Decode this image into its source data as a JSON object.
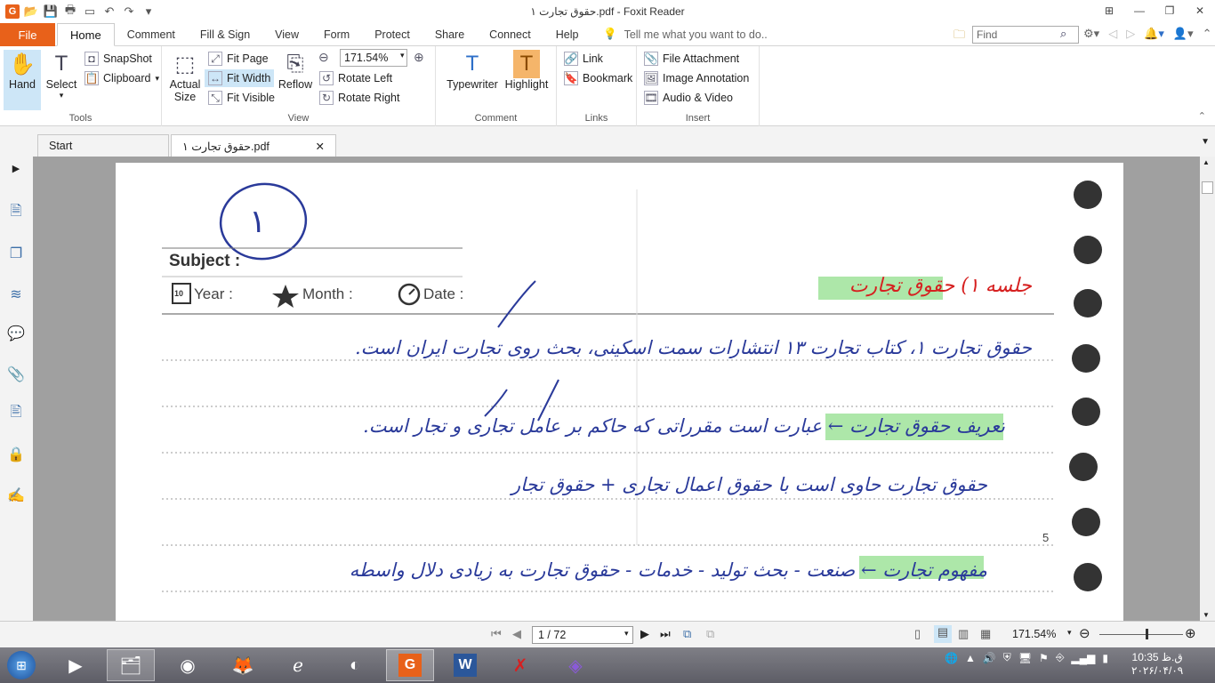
{
  "window": {
    "title": "حقوق تجارت ۱.pdf - Foxit Reader"
  },
  "menu": {
    "file": "File",
    "tabs": [
      "Home",
      "Comment",
      "Fill & Sign",
      "View",
      "Form",
      "Protect",
      "Share",
      "Connect",
      "Help"
    ],
    "tellme": "Tell me what you want to do..",
    "find_placeholder": "Find"
  },
  "ribbon": {
    "tools": {
      "hand": "Hand",
      "select": "Select",
      "snapshot": "SnapShot",
      "clipboard": "Clipboard",
      "label": "Tools"
    },
    "view": {
      "actual_size_1": "Actual",
      "actual_size_2": "Size",
      "fit_page": "Fit Page",
      "fit_width": "Fit Width",
      "fit_visible": "Fit Visible",
      "reflow": "Reflow",
      "zoom": "171.54%",
      "rotate_left": "Rotate Left",
      "rotate_right": "Rotate Right",
      "label": "View"
    },
    "comment": {
      "typewriter": "Typewriter",
      "highlight": "Highlight",
      "label": "Comment"
    },
    "links": {
      "link": "Link",
      "bookmark": "Bookmark",
      "label": "Links"
    },
    "insert": {
      "file_attachment": "File Attachment",
      "image_annotation": "Image Annotation",
      "audio_video": "Audio & Video",
      "label": "Insert"
    }
  },
  "doc_tabs": {
    "start": "Start",
    "current": "حقوق تجارت ۱.pdf"
  },
  "page": {
    "circled_number": "۱",
    "subject": "Subject :",
    "year": "Year :",
    "month": "Month :",
    "date": "Date :",
    "calendar_num": "10",
    "heading": "جلسه ۱) حقوق تجارت",
    "line1": "حقوق تجارت ۱، کتاب تجارت ۱۳ انتشارات سمت اسکینی، بحث روی تجارت ایران است.",
    "line2": "تعریف حقوق تجارت ← عبارت است مقرراتی که حاکم بر عامل تجاری و تجار است.",
    "line3": "حقوق تجارت حاوی است با حقوق اعمال تجاری + حقوق تجار",
    "line4": "مفهوم تجارت ← صنعت - بحث تولید - خدمات - حقوق تجارت به زیادی دلال واسطه",
    "margin_number": "5"
  },
  "status": {
    "page_indicator": "1 / 72",
    "zoom": "171.54%"
  },
  "clock": {
    "time": "10:35 ق.ظ",
    "date": "۲۰۲۶/۰۴/۰۹"
  },
  "colors": {
    "accent": "#e8611a",
    "ink": "#2a3a9a",
    "highlight": "#9fe39a",
    "red_ink": "#d62020"
  }
}
